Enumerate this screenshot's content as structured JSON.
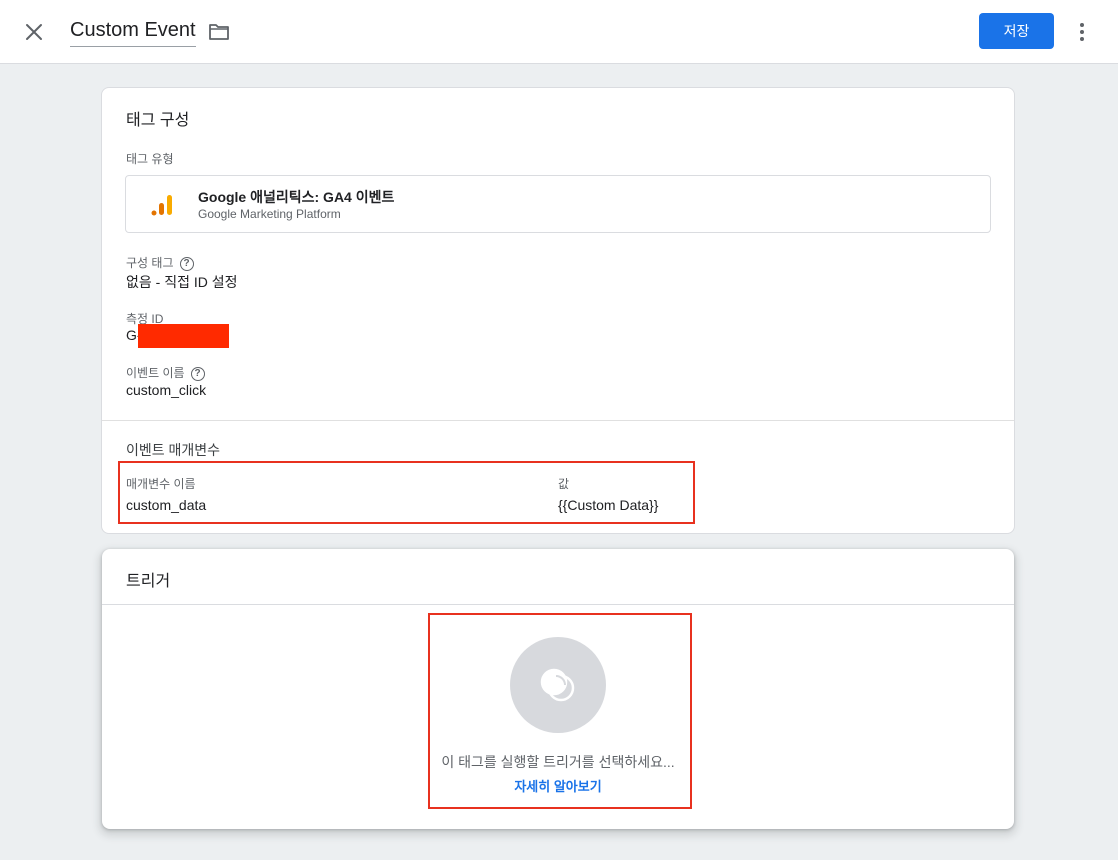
{
  "header": {
    "title": "Custom Event",
    "save_label": "저장"
  },
  "tag_config": {
    "section_title": "태그 구성",
    "tag_type_label": "태그 유형",
    "tag_type_name": "Google 애널리틱스: GA4 이벤트",
    "tag_type_platform": "Google Marketing Platform",
    "config_tag_label": "구성 태그",
    "config_tag_value": "없음 - 직접 ID 설정",
    "measurement_id_label": "측정 ID",
    "measurement_id_value": "G-",
    "event_name_label": "이벤트 이름",
    "event_name_value": "custom_click",
    "event_params_title": "이벤트 매개변수",
    "param_name_header": "매개변수 이름",
    "param_value_header": "값",
    "params": [
      {
        "name": "custom_data",
        "value": "{{Custom Data}}"
      }
    ]
  },
  "trigger": {
    "section_title": "트리거",
    "prompt": "이 태그를 실행할 트리거를 선택하세요...",
    "learn_more": "자세히 알아보기"
  },
  "colors": {
    "accent": "#1a73e8",
    "highlight_border": "#e8311f",
    "redaction": "#ff2a00",
    "analytics_orange": "#f9ab00",
    "analytics_dark_orange": "#e37400"
  },
  "icons": [
    "close-icon",
    "folder-icon",
    "more-vert-icon",
    "google-analytics-icon",
    "help-icon",
    "trigger-icon"
  ]
}
